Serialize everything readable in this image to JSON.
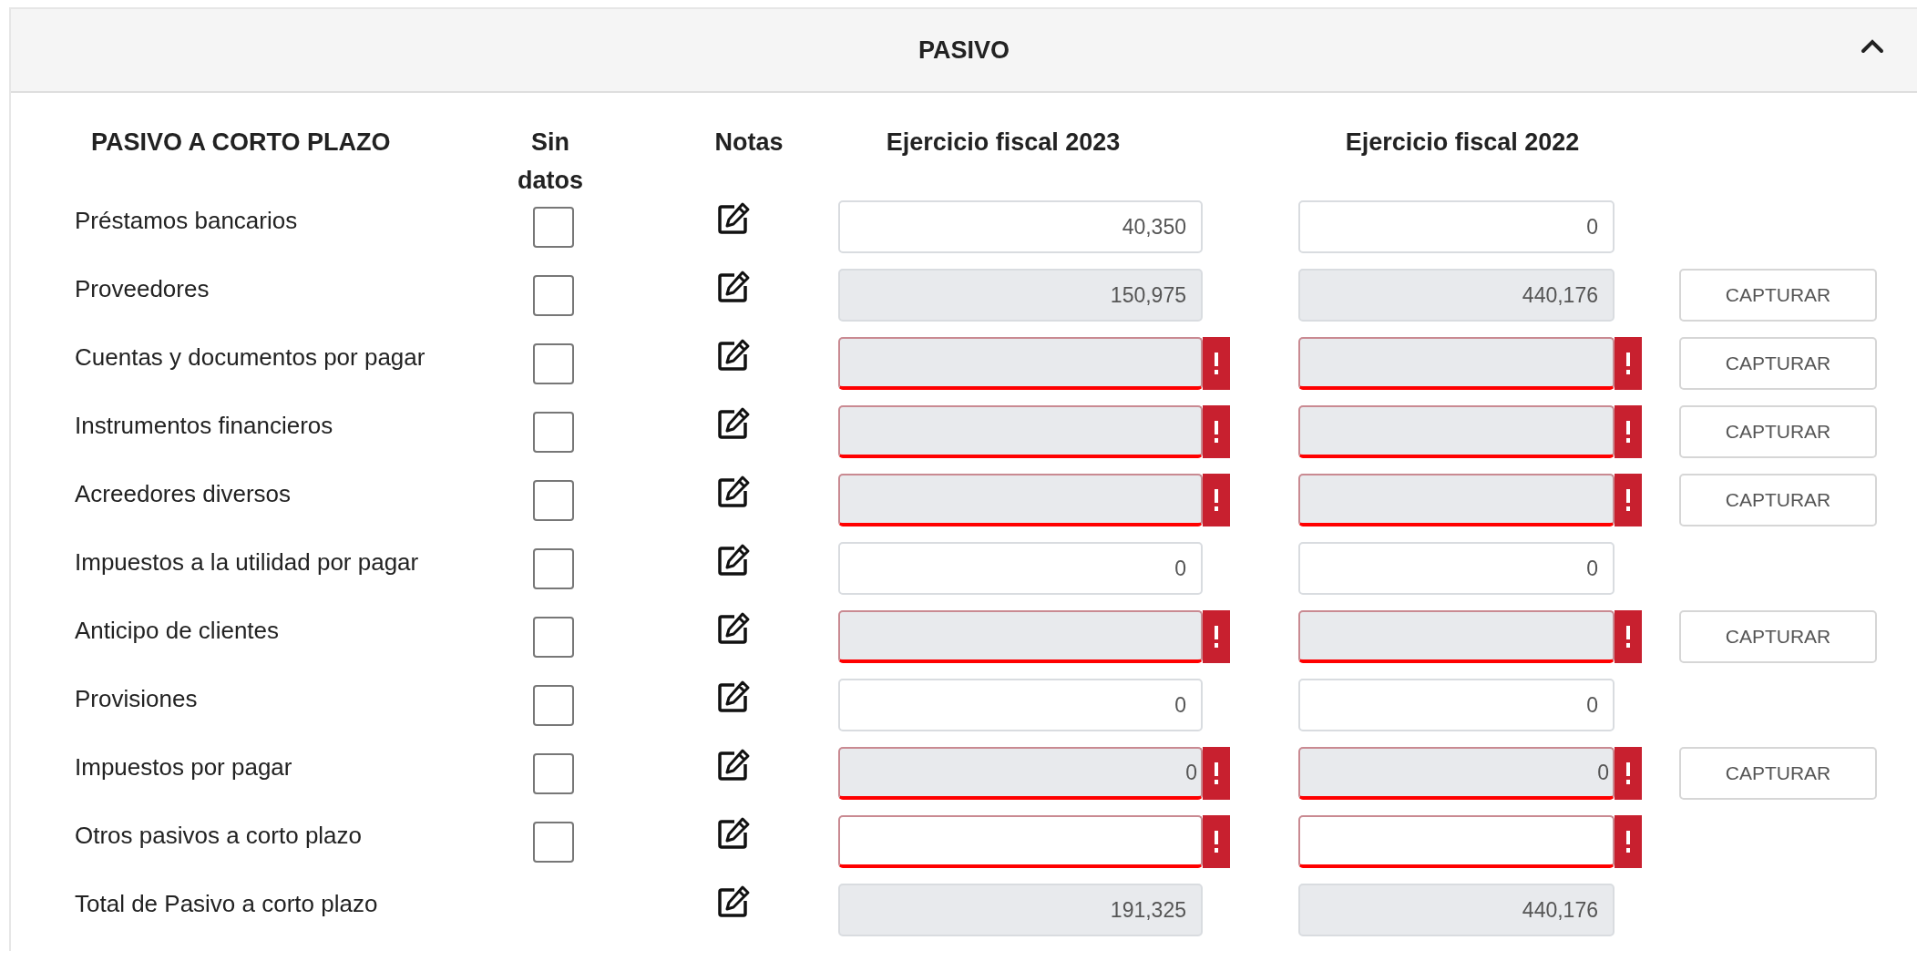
{
  "panel": {
    "title": "PASIVO",
    "expanded": true
  },
  "section": {
    "title": "PASIVO A CORTO PLAZO"
  },
  "columns": {
    "no_data": "Sin datos",
    "notes": "Notas",
    "year_1": "Ejercicio fiscal 2023",
    "year_2": "Ejercicio fiscal 2022"
  },
  "rows": [
    {
      "label": "Préstamos bancarios",
      "no_data": false,
      "fields": [
        {
          "value": "40,350",
          "kind": "input",
          "error": false
        },
        {
          "value": "0",
          "kind": "input",
          "error": false
        }
      ]
    },
    {
      "label": "Proveedores",
      "no_data": false,
      "fields": [
        {
          "value": "150,975",
          "kind": "calculated",
          "error": false
        },
        {
          "value": "440,176",
          "kind": "calculated",
          "error": false
        }
      ],
      "action": "CAPTURAR"
    },
    {
      "label": "Cuentas y documentos por pagar",
      "no_data": false,
      "fields": [
        {
          "kind": "calculated",
          "error": true
        },
        {
          "kind": "calculated",
          "error": true
        }
      ],
      "action": "CAPTURAR"
    },
    {
      "label": "Instrumentos financieros",
      "no_data": false,
      "fields": [
        {
          "kind": "calculated",
          "error": true
        },
        {
          "kind": "calculated",
          "error": true
        }
      ],
      "action": "CAPTURAR"
    },
    {
      "label": "Acreedores diversos",
      "no_data": false,
      "fields": [
        {
          "kind": "calculated",
          "error": true
        },
        {
          "kind": "calculated",
          "error": true
        }
      ],
      "action": "CAPTURAR"
    },
    {
      "label": "Impuestos a la utilidad por pagar",
      "no_data": false,
      "fields": [
        {
          "value": "0",
          "kind": "input",
          "error": false
        },
        {
          "value": "0",
          "kind": "input",
          "error": false
        }
      ]
    },
    {
      "label": "Anticipo de clientes",
      "no_data": false,
      "fields": [
        {
          "kind": "calculated",
          "error": true
        },
        {
          "kind": "calculated",
          "error": true
        }
      ],
      "action": "CAPTURAR"
    },
    {
      "label": "Provisiones",
      "no_data": false,
      "fields": [
        {
          "value": "0",
          "kind": "input",
          "error": false
        },
        {
          "value": "0",
          "kind": "input",
          "error": false
        }
      ]
    },
    {
      "label": "Impuestos por pagar",
      "no_data": false,
      "fields": [
        {
          "value": "0",
          "kind": "calculated",
          "error": true
        },
        {
          "value": "0",
          "kind": "calculated",
          "error": true
        }
      ],
      "action": "CAPTURAR"
    },
    {
      "label": "Otros pasivos a corto plazo",
      "no_data": false,
      "fields": [
        {
          "kind": "input",
          "error": true
        },
        {
          "kind": "input",
          "error": true
        }
      ]
    },
    {
      "label": "Total de Pasivo a corto plazo",
      "fields": [
        {
          "value": "191,325",
          "kind": "calculated",
          "error": false
        },
        {
          "value": "440,176",
          "kind": "calculated",
          "error": false
        }
      ]
    }
  ]
}
